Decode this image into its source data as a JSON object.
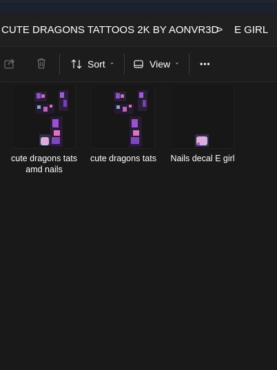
{
  "breadcrumb": {
    "folder": "CUTE DRAGONS TATTOOS 2K BY AONVR3D",
    "subfolder": "E GIRL",
    "separator": ">"
  },
  "toolbar": {
    "share_icon": "share-icon",
    "delete_icon": "trash-icon",
    "sort_label": "Sort",
    "view_label": "View",
    "more_label": "•••"
  },
  "files": [
    {
      "name": "cute dragons tats amd nails",
      "thumbnail": "tattoo-texture"
    },
    {
      "name": "cute dragons tats",
      "thumbnail": "tattoo-texture"
    },
    {
      "name": "Nails decal E girl",
      "thumbnail": "nail-texture"
    }
  ],
  "colors": {
    "background": "#191919",
    "toolbar": "#1c1c1c",
    "addressbar": "#202020",
    "accent_purple": "#a05bd6",
    "accent_pink": "#e070c0"
  }
}
